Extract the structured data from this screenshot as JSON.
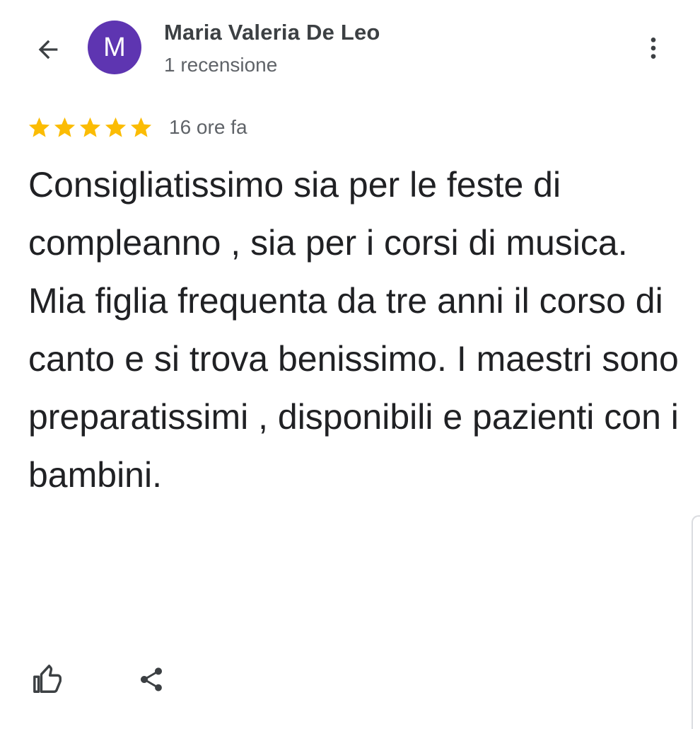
{
  "header": {
    "avatar_letter": "M",
    "avatar_color": "#5e35b1",
    "author_name": "Maria Valeria De Leo",
    "author_subtitle": "1 recensione",
    "back_icon": "arrow-back-icon",
    "more_icon": "more-vert-icon"
  },
  "review": {
    "rating": 5,
    "rating_max": 5,
    "star_color": "#fbbc04",
    "time_ago": "16 ore fa",
    "text": "Consigliatissimo sia per le feste di compleanno , sia per i corsi di musica.\nMia figlia frequenta da tre anni il corso di canto e si trova benissimo. I maestri sono preparatissimi , disponibili e pazienti con i bambini."
  },
  "actions": {
    "like_icon": "thumb-up-icon",
    "share_icon": "share-icon"
  }
}
